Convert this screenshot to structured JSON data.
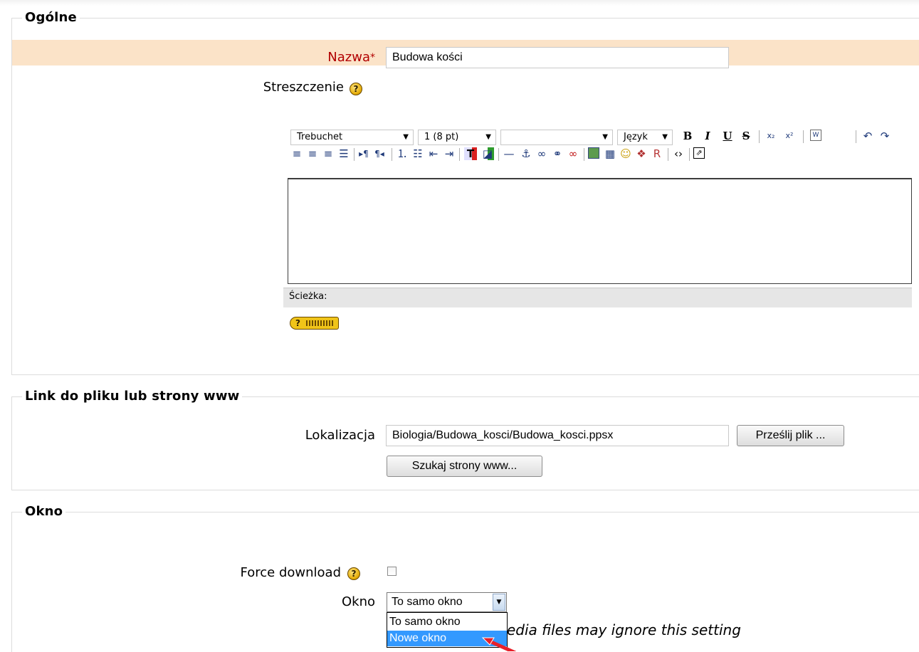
{
  "sections": {
    "general": {
      "legend": "Ogólne",
      "name_label": "Nazwa",
      "required_mark": "*",
      "name_value": "Budowa kości",
      "summary_label": "Streszczenie",
      "help_glyph": "?"
    },
    "editor": {
      "font_family": "Trebuchet",
      "font_size": "1 (8 pt)",
      "style": "",
      "language": "Język",
      "bold": "B",
      "italic": "I",
      "underline": "U",
      "strike": "S",
      "path_label": "Ścieżka:",
      "keyboard_help_glyph": "?",
      "toolbar_row1_icons": [
        "subscript-icon",
        "superscript-icon",
        "paste-word-icon",
        "undo-icon",
        "redo-icon"
      ],
      "toolbar_row2_icons": [
        "align-left-icon",
        "align-center-icon",
        "align-right-icon",
        "justify-icon",
        "ltr-icon",
        "rtl-icon",
        "ordered-list-icon",
        "unordered-list-icon",
        "outdent-icon",
        "indent-icon",
        "text-color-icon",
        "background-color-icon",
        "horizontal-rule-icon",
        "anchor-icon",
        "link-icon",
        "unlink-icon",
        "nolink-icon",
        "image-icon",
        "table-icon",
        "smiley-icon",
        "insert-char-icon",
        "search-replace-icon",
        "html-source-icon",
        "fullscreen-icon"
      ]
    },
    "link": {
      "legend": "Link do pliku lub strony www",
      "location_label": "Lokalizacja",
      "location_value": "Biologia/Budowa_kosci/Budowa_kosci.ppsx",
      "upload_button": "Prześlij plik ...",
      "search_button": "Szukaj strony www..."
    },
    "window": {
      "legend": "Okno",
      "force_download_label": "Force download",
      "force_download_checked": false,
      "window_label": "Okno",
      "window_selected": "To samo okno",
      "window_options": [
        "To samo okno",
        "Nowe okno"
      ],
      "highlighted_option": "Nowe okno",
      "note_visible": "edia files may ignore this setting"
    }
  },
  "colors": {
    "required_row_bg": "#fbe3c8",
    "required_label": "#b20000",
    "dropdown_highlight": "#3399ff",
    "cursor_arrow": "#e8202a"
  }
}
